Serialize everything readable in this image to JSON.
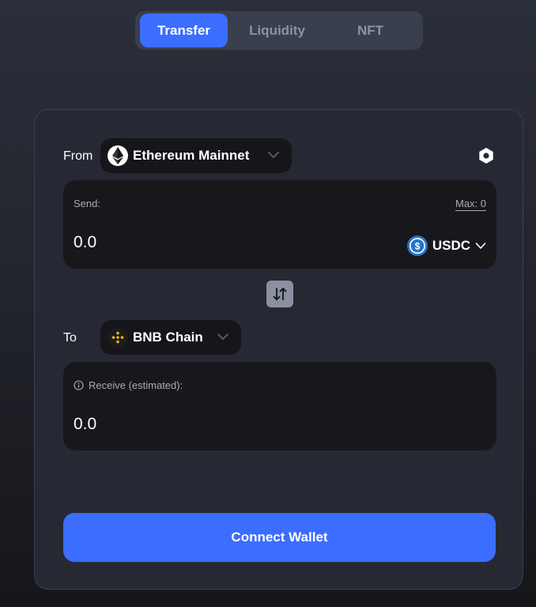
{
  "tabs": [
    {
      "label": "Transfer",
      "active": true
    },
    {
      "label": "Liquidity",
      "active": false
    },
    {
      "label": "NFT",
      "active": false
    }
  ],
  "transfer": {
    "from_label": "From",
    "from_chain": {
      "name": "Ethereum Mainnet",
      "icon": "ethereum-icon"
    },
    "settings_icon": "settings-icon",
    "send": {
      "label": "Send:",
      "max_label": "Max: 0",
      "amount": "0.0",
      "token": {
        "name": "USDC",
        "icon": "usdc-icon"
      }
    },
    "swap_icon": "swap-direction-icon",
    "to_label": "To",
    "to_chain": {
      "name": "BNB Chain",
      "icon": "bnb-icon"
    },
    "receive": {
      "label": "Receive (estimated):",
      "amount": "0.0",
      "info_icon": "info-icon"
    },
    "connect_button": "Connect Wallet"
  },
  "colors": {
    "accent": "#3b6dff",
    "card_background": "#262934",
    "panel_background": "#18181c",
    "usdc_blue": "#2775ca",
    "bnb_yellow": "#f0b90b"
  }
}
